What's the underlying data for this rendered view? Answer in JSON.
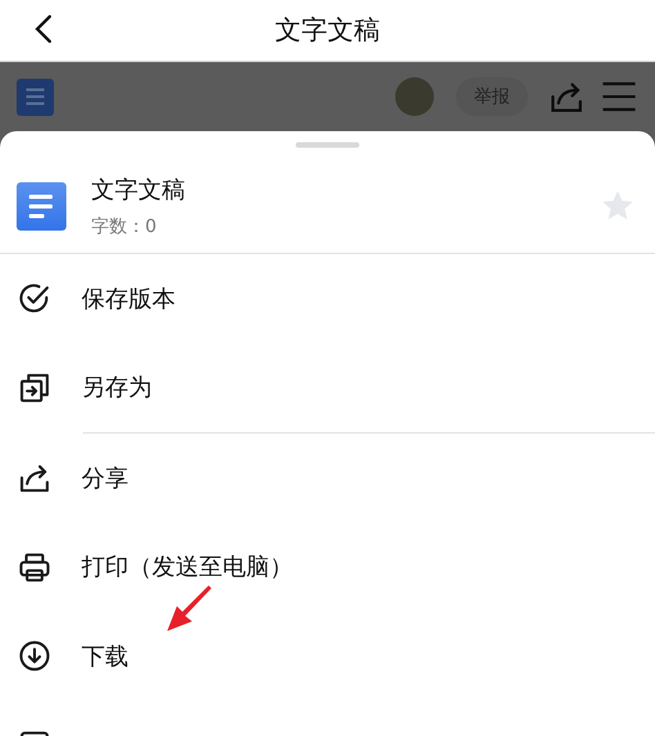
{
  "nav": {
    "title": "文字文稿"
  },
  "toolbar": {
    "report": "举报"
  },
  "sheet": {
    "doc_title": "文字文稿",
    "word_count": "字数：0",
    "starred": false,
    "items": [
      {
        "kind": "save-version",
        "label": "保存版本",
        "divider_after": false
      },
      {
        "kind": "save-as",
        "label": "另存为",
        "divider_after": true
      },
      {
        "kind": "share",
        "label": "分享",
        "divider_after": false
      },
      {
        "kind": "print",
        "label": "打印（发送至电脑）",
        "divider_after": false
      },
      {
        "kind": "download",
        "label": "下载",
        "divider_after": false
      },
      {
        "kind": "export-image"
      }
    ]
  }
}
